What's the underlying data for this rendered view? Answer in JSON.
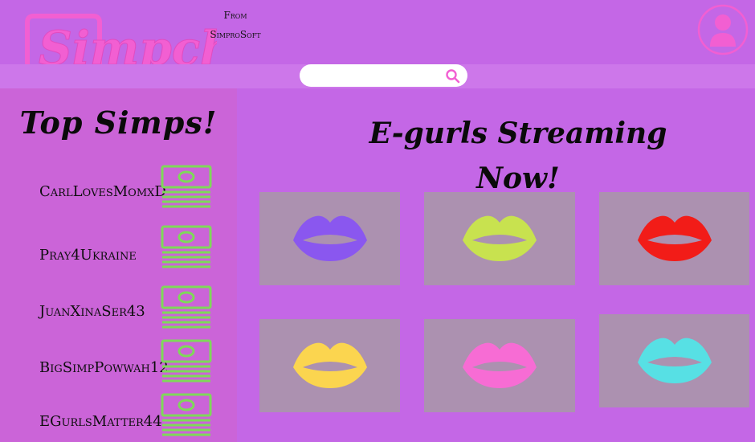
{
  "app": {
    "logo_text": "Simpch",
    "from_line1": "From",
    "from_line2": "SimproSoft"
  },
  "search": {
    "placeholder": "",
    "value": ""
  },
  "sidebar": {
    "title": "Top Simps!",
    "items": [
      {
        "name": "CarlLovesMomxD"
      },
      {
        "name": "Pray4Ukraine"
      },
      {
        "name": "JuanXinaSer43"
      },
      {
        "name": "BigSimpPowwah12"
      },
      {
        "name": "EGurlsMatter44"
      }
    ]
  },
  "main": {
    "title_line1": "E-gurls Streaming",
    "title_line2": "Now!",
    "streams": [
      {
        "lips_color": "#8a57ef"
      },
      {
        "lips_color": "#c8e24f"
      },
      {
        "lips_color": "#f21c18"
      },
      {
        "lips_color": "#fbd54f"
      },
      {
        "lips_color": "#f76cd4"
      },
      {
        "lips_color": "#57e0e4"
      }
    ]
  },
  "colors": {
    "background": "#c467e6",
    "sidebar": "#cb64d8",
    "logo_pink": "#f25fd2",
    "cash_green": "#7fd85a",
    "tile": "#ac91b0"
  },
  "icons": {
    "avatar": "user-avatar-icon",
    "search": "magnifier-icon",
    "cash": "money-stack-icon",
    "stream": "lips-icon"
  }
}
